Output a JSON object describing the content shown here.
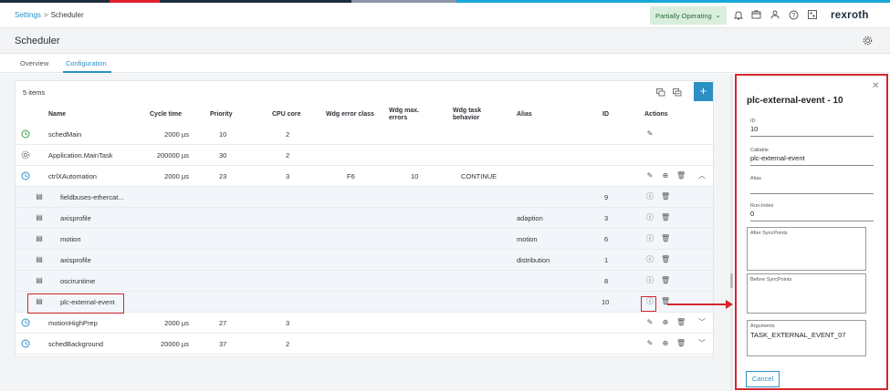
{
  "colors": {
    "accent": "#2d8fc4",
    "highlight": "#d3262c",
    "status_bg": "#d9efdc",
    "status_fg": "#2f6b3a",
    "row_icon_green": "#3aa049",
    "row_icon_blue": "#2d8fc4",
    "stripe": [
      "#1d2b3a",
      "#e0202e",
      "#1d2b3a",
      "#8a96a3",
      "#18a7d8"
    ]
  },
  "topbar": {
    "breadcrumb_root": "Settings",
    "breadcrumb_sep": ">",
    "breadcrumb_current": "Scheduler",
    "status": "Partially Operating",
    "status_icon": "chevron-down-icon",
    "icons": [
      "bell-icon",
      "package-icon",
      "user-icon",
      "help-icon",
      "qr-icon"
    ],
    "logo": "rexroth"
  },
  "page": {
    "title": "Scheduler",
    "settings_icon": "gear-icon"
  },
  "tabs": [
    {
      "label": "Overview",
      "active": false
    },
    {
      "label": "Configuration",
      "active": true
    }
  ],
  "table": {
    "items_count": "5 items",
    "toolbar_icons": [
      "copy-icon",
      "paste-icon"
    ],
    "add_label": "+",
    "columns": {
      "name": "Name",
      "cycle": "Cycle time",
      "priority": "Priority",
      "cpu": "CPU core",
      "wdg_class": "Wdg error class",
      "wdg_max": "Wdg max. errors",
      "wdg_behavior": "Wdg task behavior",
      "alias": "Alias",
      "id": "ID",
      "actions": "Actions"
    },
    "rows": [
      {
        "name": "schedMain",
        "cycle": "2000 µs",
        "priority": "10",
        "cpu": "2",
        "wdg_class": "",
        "wdg_max": "",
        "wdg_behavior": "",
        "alias": "",
        "id": "",
        "icon": "clock-icon"
      },
      {
        "name": "Application.MainTask",
        "cycle": "200000 µs",
        "priority": "30",
        "cpu": "2",
        "wdg_class": "",
        "wdg_max": "",
        "wdg_behavior": "",
        "alias": "",
        "id": "",
        "icon": "gear-icon"
      },
      {
        "name": "ctrlXAutomation",
        "cycle": "2000 µs",
        "priority": "23",
        "cpu": "3",
        "wdg_class": "F6",
        "wdg_max": "10",
        "wdg_behavior": "CONTINUE",
        "alias": "",
        "id": "",
        "icon": "clock-icon"
      },
      {
        "name": "fieldbuses-ethercat...",
        "alias": "",
        "id": "9",
        "icon": "callable-icon"
      },
      {
        "name": "axisprofile",
        "alias": "adaption",
        "id": "3",
        "icon": "callable-icon"
      },
      {
        "name": "motion",
        "alias": "motion",
        "id": "6",
        "icon": "callable-icon"
      },
      {
        "name": "axisprofile",
        "alias": "distribution",
        "id": "1",
        "icon": "callable-icon"
      },
      {
        "name": "osciruntime",
        "alias": "",
        "id": "8",
        "icon": "callable-icon"
      },
      {
        "name": "plc-external-event",
        "alias": "",
        "id": "10",
        "icon": "callable-icon"
      },
      {
        "name": "motionHighPrep",
        "cycle": "2000 µs",
        "priority": "27",
        "cpu": "3",
        "wdg_class": "",
        "wdg_max": "",
        "wdg_behavior": "",
        "alias": "",
        "id": "",
        "icon": "clock-icon"
      },
      {
        "name": "schedBackground",
        "cycle": "20000 µs",
        "priority": "37",
        "cpu": "2",
        "wdg_class": "",
        "wdg_max": "",
        "wdg_behavior": "",
        "alias": "",
        "id": "",
        "icon": "clock-icon"
      }
    ]
  },
  "panel": {
    "title": "plc-external-event - 10",
    "close_icon": "close-icon",
    "id_label": "ID",
    "id_value": "10",
    "callable_label": "Callable",
    "callable_value": "plc-external-event",
    "alias_label": "Alias",
    "alias_value": "",
    "runindex_label": "Run-Index",
    "runindex_value": "0",
    "after_label": "After SyncPoints",
    "before_label": "Before SyncPoints",
    "arguments_label": "Arguments",
    "arguments_value": "TASK_EXTERNAL_EVENT_07",
    "cancel_label": "Cancel"
  }
}
